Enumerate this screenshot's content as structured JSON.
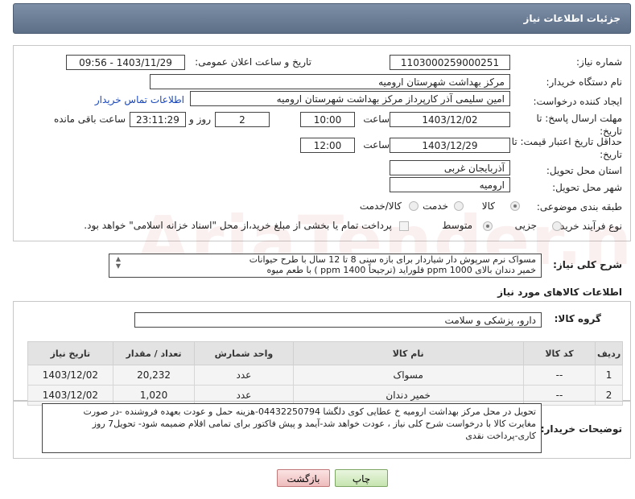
{
  "header": {
    "title": "جزئیات اطلاعات نیاز"
  },
  "form": {
    "need_number_label": "شماره نیاز:",
    "need_number": "1103000259000251",
    "announce_label": "تاریخ و ساعت اعلان عمومی:",
    "announce_value": "1403/11/29 - 09:56",
    "buyer_label": "نام دستگاه خریدار:",
    "buyer": "مرکز بهداشت شهرستان ارومیه",
    "requester_label": "ایجاد کننده درخواست:",
    "requester": "امین سلیمی آذر کارپرداز مرکز بهداشت شهرستان ارومیه",
    "contact_link": "اطلاعات تماس خریدار",
    "deadline_label": "مهلت ارسال پاسخ: تا تاریخ:",
    "deadline_date": "1403/12/02",
    "time_label": "ساعت",
    "deadline_time": "10:00",
    "days_value": "2",
    "days_label": "روز و",
    "remaining_time": "23:11:29",
    "remaining_label": "ساعت باقی مانده",
    "min_validity_label": "حداقل تاریخ اعتبار قیمت: تا تاریخ:",
    "validity_date": "1403/12/29",
    "validity_time": "12:00",
    "province_label": "استان محل تحویل:",
    "province": "آذربایجان غربی",
    "city_label": "شهر محل تحویل:",
    "city": "ارومیه",
    "category_label": "طبقه بندی موضوعی:",
    "category_options": [
      "کالا",
      "خدمت",
      "کالا/خدمت"
    ],
    "process_label": "نوع فرآیند خرید :",
    "process_options": [
      "جزیی",
      "متوسط"
    ],
    "payment_note": "پرداخت تمام یا بخشی از مبلغ خرید،از محل \"اسناد خزانه اسلامی\" خواهد بود."
  },
  "summary": {
    "label": "شرح کلی نیاز:",
    "line1": "مسواک نرم سرپوش دار  شیاردار برای بازه سنی 8 تا 12 سال با طرح حیوانات",
    "line2": "خمیر دندان بالای ppm 1000 فلوراید (ترجیحاً  ppm 1400 ) با طعم میوه"
  },
  "goods": {
    "section_title": "اطلاعات کالاهای مورد نیاز",
    "group_label": "گروه کالا:",
    "group_value": "دارو، پزشکی و سلامت",
    "columns": [
      "ردیف",
      "کد کالا",
      "نام کالا",
      "واحد شمارش",
      "تعداد / مقدار",
      "تاریخ نیاز"
    ],
    "rows": [
      [
        "1",
        "--",
        "مسواک",
        "عدد",
        "20,232",
        "1403/12/02"
      ],
      [
        "2",
        "--",
        "خمیر دندان",
        "عدد",
        "1,020",
        "1403/12/02"
      ]
    ]
  },
  "notes": {
    "label": "توضیحات خریدار:",
    "line1": "تحویل در محل مرکز بهداشت ارومیه خ عطایی کوی دلگشا 04432250794-هزینه حمل و عودت بعهده فروشنده -در صورت",
    "line2": "مغایرت کالا با درخواست شرح کلی نیاز ، عودت خواهد شد-آیمد و پیش فاکتور برای تمامی اقلام ضمیمه شود- تحویل7 روز",
    "line3": "کاری-پرداخت نقدی"
  },
  "buttons": {
    "print": "چاپ",
    "back": "بازگشت"
  },
  "watermark": "AriaTender.neT",
  "colors": {
    "header_bg": "#6a7d95",
    "link": "#1a48b8",
    "print_btn": "#c6e4af",
    "back_btn": "#eebcbc"
  }
}
